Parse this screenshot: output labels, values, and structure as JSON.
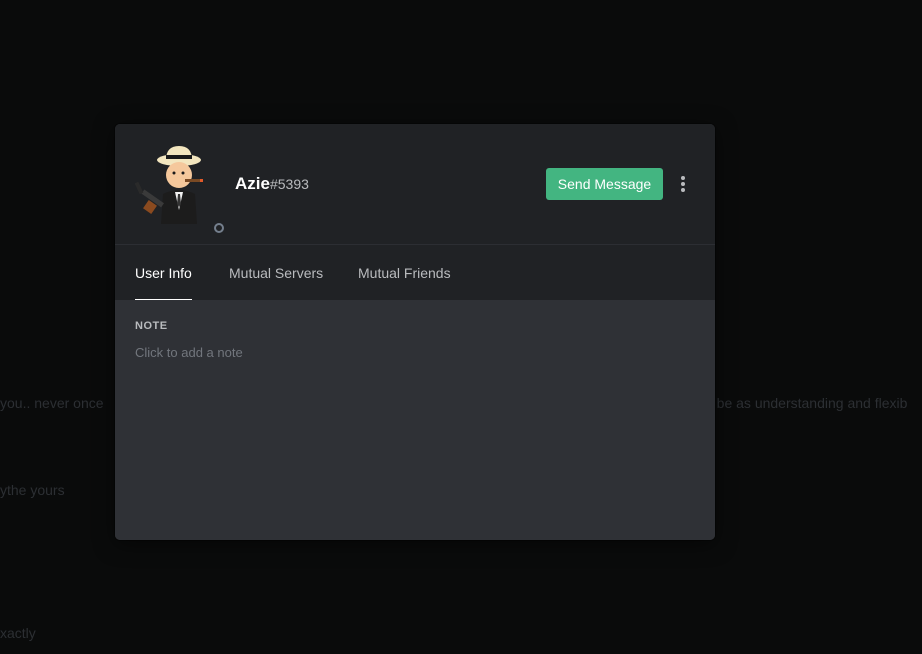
{
  "background": {
    "lines": [
      "you.. never once",
      "o be as understanding and flexib",
      "ythe yours",
      "xactly"
    ]
  },
  "profile": {
    "username": "Azie",
    "discriminator": "#5393",
    "status": "offline",
    "avatar_icon": "gangster-avatar-icon"
  },
  "actions": {
    "send_message_label": "Send Message",
    "more_icon": "more-vertical-icon"
  },
  "tabs": [
    {
      "label": "User Info",
      "active": true
    },
    {
      "label": "Mutual Servers",
      "active": false
    },
    {
      "label": "Mutual Friends",
      "active": false
    }
  ],
  "note": {
    "title": "NOTE",
    "placeholder": "Click to add a note",
    "value": ""
  },
  "colors": {
    "accent_green": "#43b581",
    "header_bg": "#202225",
    "body_bg": "#2f3136"
  }
}
